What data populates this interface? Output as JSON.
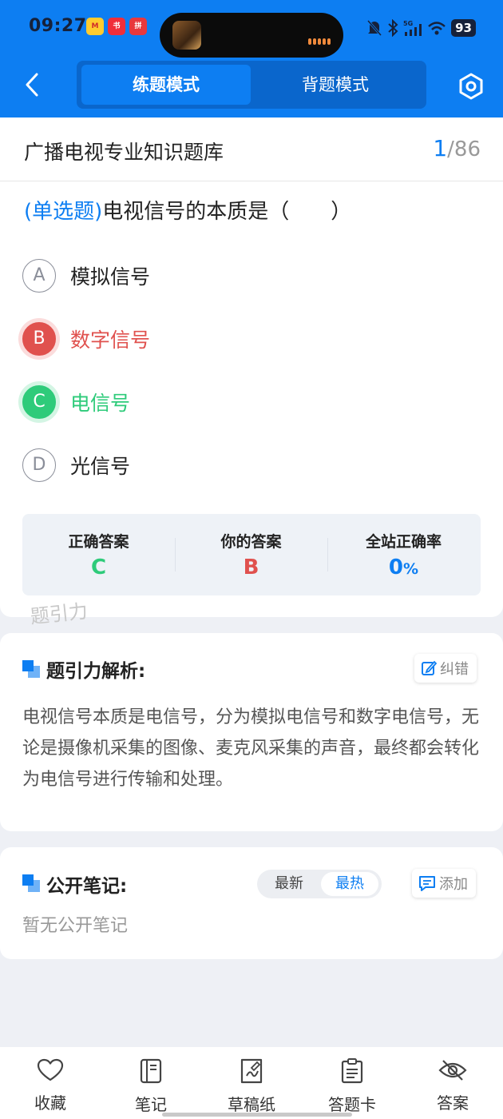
{
  "status_bar": {
    "time": "09:27",
    "battery": "93",
    "app_icons": [
      "mall-app-icon",
      "xiaohongshu-icon",
      "pinduoduo-icon"
    ]
  },
  "header": {
    "modes": [
      "练题模式",
      "背题模式"
    ],
    "active_mode": "练题模式"
  },
  "question": {
    "bank_title": "广播电视专业知识题库",
    "progress_current": "1",
    "progress_total": "/86",
    "type": "(单选题)",
    "text": "电视信号的本质是（　　）",
    "options": [
      {
        "letter": "A",
        "text": "模拟信号",
        "state": "normal"
      },
      {
        "letter": "B",
        "text": "数字信号",
        "state": "wrong"
      },
      {
        "letter": "C",
        "text": "电信号",
        "state": "correct"
      },
      {
        "letter": "D",
        "text": "光信号",
        "state": "normal"
      }
    ]
  },
  "stats": {
    "correct_label": "正确答案",
    "correct_value": "C",
    "yours_label": "你的答案",
    "yours_value": "B",
    "rate_label": "全站正确率",
    "rate_value": "0",
    "rate_unit": "%"
  },
  "watermark": "题引力",
  "analysis": {
    "title": "题引力解析:",
    "correct_btn": "纠错",
    "body": "电视信号本质是电信号，分为模拟电信号和数字电信号，无论是摄像机采集的图像、麦克风采集的声音，最终都会转化为电信号进行传输和处理。"
  },
  "notes": {
    "title": "公开笔记:",
    "sort_options": [
      "最新",
      "最热"
    ],
    "active_sort": "最热",
    "add_btn": "添加",
    "empty_text": "暂无公开笔记"
  },
  "bottom_nav": [
    {
      "label": "收藏",
      "icon": "heart-icon"
    },
    {
      "label": "笔记",
      "icon": "notebook-icon"
    },
    {
      "label": "草稿纸",
      "icon": "draft-icon"
    },
    {
      "label": "答题卡",
      "icon": "answer-card-icon"
    },
    {
      "label": "答案",
      "icon": "eye-off-icon"
    }
  ],
  "colors": {
    "brand": "#0d7ef2",
    "wrong": "#e0514e",
    "correct": "#2ecb7a"
  }
}
